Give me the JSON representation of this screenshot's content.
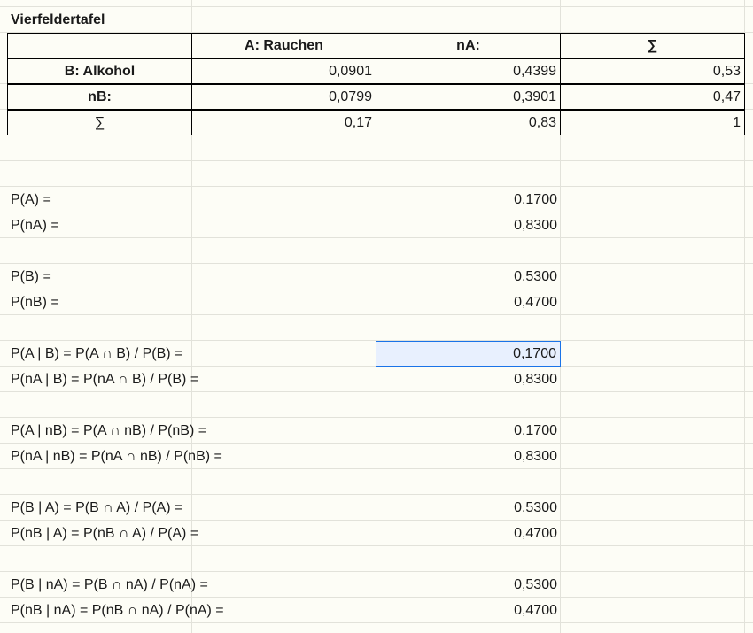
{
  "title": "Vierfeldertafel",
  "table": {
    "headers": [
      "",
      "A: Rauchen",
      "nA:",
      "∑"
    ],
    "rows": [
      {
        "label": "B: Alkohol",
        "values": [
          "0,0901",
          "0,4399",
          "0,53"
        ]
      },
      {
        "label": "nB:",
        "values": [
          "0,0799",
          "0,3901",
          "0,47"
        ]
      },
      {
        "label": "∑",
        "values": [
          "0,17",
          "0,83",
          "1"
        ]
      }
    ]
  },
  "probabilities": [
    {
      "label": "P(A) =",
      "value": "0,1700"
    },
    {
      "label": "P(nA) =",
      "value": "0,8300"
    },
    {
      "label": "P(B) =",
      "value": "0,5300"
    },
    {
      "label": "P(nB) =",
      "value": "0,4700"
    },
    {
      "label": "P(A | B) = P(A ∩ B) / P(B) =",
      "value": "0,1700"
    },
    {
      "label": "P(nA | B) = P(nA ∩ B) / P(B) =",
      "value": "0,8300"
    },
    {
      "label": "P(A | nB) = P(A ∩ nB) / P(nB) =",
      "value": "0,1700"
    },
    {
      "label": "P(nA | nB) = P(nA ∩ nB) / P(nB) =",
      "value": "0,8300"
    },
    {
      "label": "P(B | A) = P(B ∩ A) / P(A) =",
      "value": "0,5300"
    },
    {
      "label": "P(nB | A) = P(nB ∩ A) / P(A) =",
      "value": "0,4700"
    },
    {
      "label": "P(B | nA) = P(B ∩ nA) / P(nA) =",
      "value": "0,5300"
    },
    {
      "label": "P(nB | nA) = P(nB ∩ nA) / P(nA) =",
      "value": "0,4700"
    }
  ],
  "colors": {
    "gridline": "#e2e2da",
    "selection_fill": "#e8f0fe",
    "selection_border": "#1a73e8"
  }
}
